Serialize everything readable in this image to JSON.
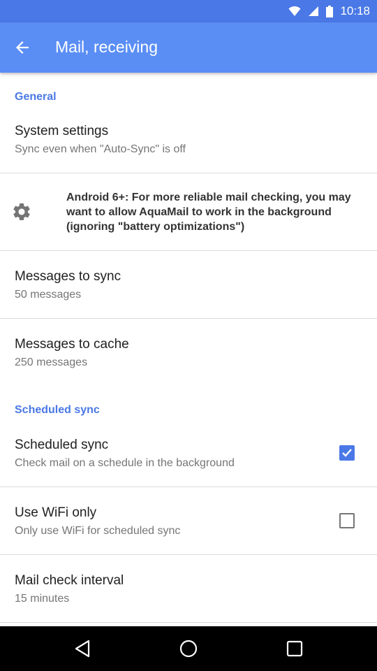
{
  "status_bar": {
    "time": "10:18"
  },
  "app_bar": {
    "title": "Mail, receiving"
  },
  "sections": {
    "general": "General",
    "scheduled": "Scheduled sync"
  },
  "items": {
    "system_settings": {
      "title": "System settings",
      "subtitle": "Sync even when \"Auto-Sync\" is off"
    },
    "android_notice": "Android 6+: For more reliable mail checking, you may want to allow AquaMail to work in the background (ignoring \"battery optimizations\")",
    "messages_to_sync": {
      "title": "Messages to sync",
      "subtitle": "50 messages"
    },
    "messages_to_cache": {
      "title": "Messages to cache",
      "subtitle": "250 messages"
    },
    "scheduled_sync": {
      "title": "Scheduled sync",
      "subtitle": "Check mail on a schedule in the background",
      "checked": true
    },
    "wifi_only": {
      "title": "Use WiFi only",
      "subtitle": "Only use WiFi for scheduled sync",
      "checked": false
    },
    "mail_check_interval": {
      "title": "Mail check interval",
      "subtitle": "15 minutes"
    }
  },
  "icons": {
    "back": "arrow-back-icon",
    "settings": "gear-icon",
    "nav_back": "nav-back-icon",
    "nav_home": "nav-home-icon",
    "nav_recents": "nav-recents-icon"
  },
  "colors": {
    "accent": "#4a78e6",
    "app_bar": "#5a8ef5",
    "status_bar": "#4a78e6"
  }
}
